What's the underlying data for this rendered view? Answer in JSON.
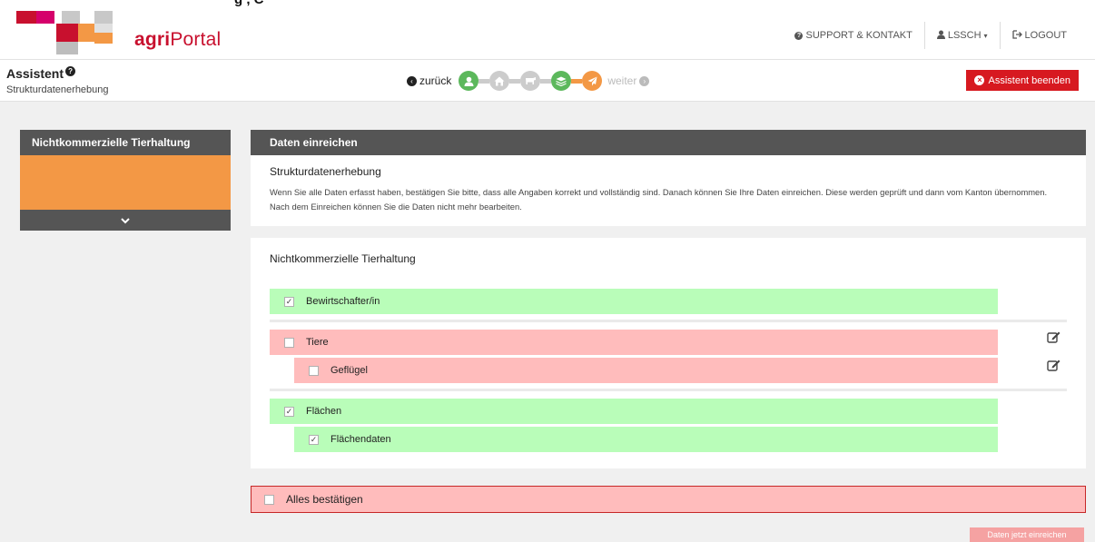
{
  "colors": {
    "brand_red": "#c8102e",
    "orange": "#f39845",
    "green_row": "#b9fdb9",
    "red_row": "#ffbcbc",
    "dark_header": "#555555",
    "danger_button": "#d71920"
  },
  "top_strip": {
    "text": "g , C"
  },
  "header": {
    "logo_bold": "agri",
    "logo_rest": "Portal",
    "nav": {
      "support": {
        "icon": "question-circle-icon",
        "label": "SUPPORT & KONTAKT"
      },
      "user": {
        "icon": "user-icon",
        "label": "LSSCH",
        "caret": "caret-down-icon"
      },
      "logout": {
        "icon": "sign-out-icon",
        "label": "LOGOUT"
      }
    }
  },
  "assistant": {
    "title": "Assistent",
    "subtitle": "Strukturdatenerhebung",
    "back_label": "zurück",
    "forward_label": "weiter",
    "end_label": "Assistent beenden",
    "steps": [
      {
        "icon": "user-icon",
        "color": "#5cb85c"
      },
      {
        "icon": "home-icon",
        "color": "#cccccc"
      },
      {
        "icon": "cow-icon",
        "color": "#cccccc"
      },
      {
        "icon": "layers-icon",
        "color": "#5cb85c"
      },
      {
        "icon": "paper-plane-icon",
        "color": "#f39845"
      }
    ]
  },
  "sidebar": {
    "title": "Nichtkommerzielle Tierhaltung",
    "toggle_icon": "chevron-down-icon"
  },
  "submit_card": {
    "header": "Daten einreichen",
    "title": "Strukturdatenerhebung",
    "text": "Wenn Sie alle Daten erfasst haben, bestätigen Sie bitte, dass alle Angaben korrekt und vollständig sind. Danach können Sie Ihre Daten einreichen. Diese werden geprüft und dann vom Kanton übernommen. Nach dem Einreichen können Sie die Daten nicht mehr bearbeiten."
  },
  "checklist": {
    "title": "Nichtkommerzielle Tierhaltung",
    "items": [
      {
        "label": "Bewirtschafter/in",
        "checked": true
      },
      {
        "label": "Tiere",
        "checked": false
      },
      {
        "label": "Geflügel",
        "checked": false
      },
      {
        "label": "Flächen",
        "checked": true
      },
      {
        "label": "Flächendaten",
        "checked": true
      }
    ]
  },
  "confirm_all": {
    "label": "Alles bestätigen",
    "checked": false
  },
  "submit_button": {
    "label": "Daten jetzt einreichen"
  }
}
